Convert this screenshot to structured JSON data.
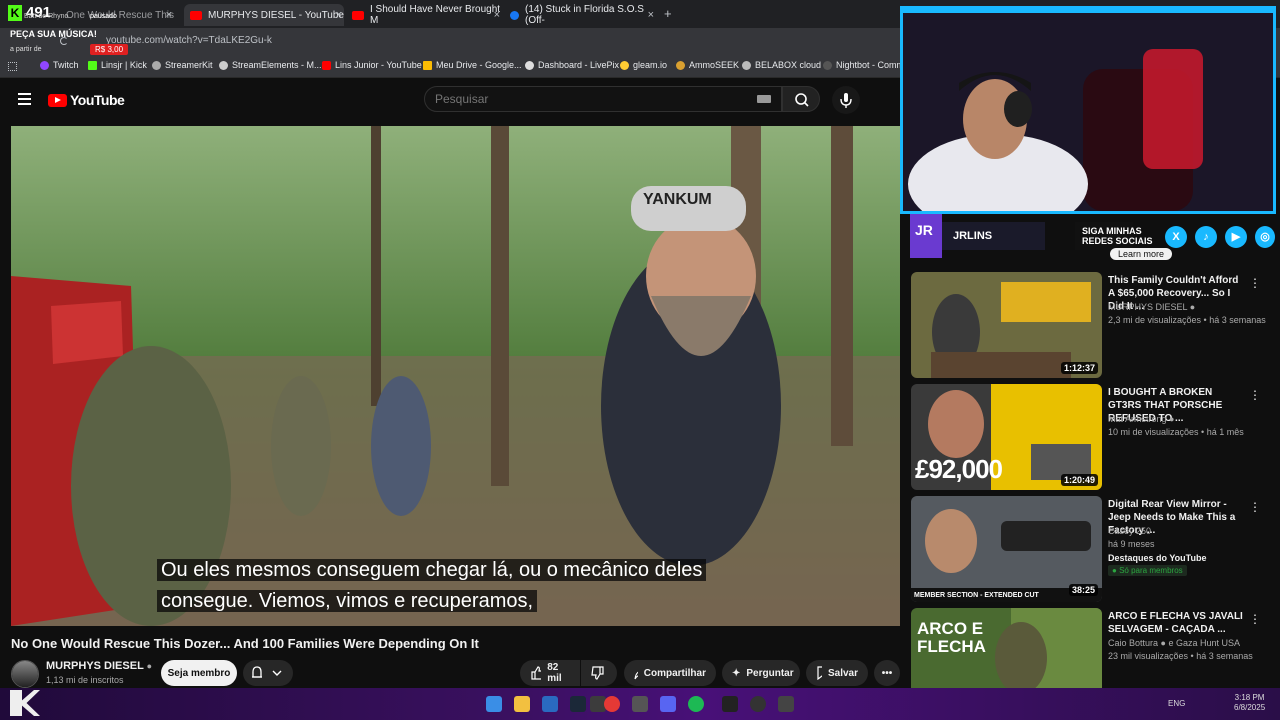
{
  "kick_overlay": {
    "count": "491",
    "title": "Batt do Rhyno",
    "status": "pausado",
    "song_request": "PEÇA SUA MÚSICA!",
    "from": "a partir de",
    "price": "R$ 3,00"
  },
  "browser": {
    "tabs": [
      {
        "label": "One Would Rescue This"
      },
      {
        "label": "MURPHYS DIESEL - YouTube"
      },
      {
        "label": "I Should Have Never Brought M"
      },
      {
        "label": "(14) Stuck in Florida S.O.S (Off-"
      }
    ],
    "new_tab": "+",
    "url": "youtube.com/watch?v=TdaLKE2Gu-k",
    "bookmarks": [
      {
        "label": "Twitch",
        "color": "#9146ff"
      },
      {
        "label": "Linsjr | Kick",
        "color": "#53fc18"
      },
      {
        "label": "StreamerKit",
        "color": "#aaaaaa"
      },
      {
        "label": "StreamElements - M...",
        "color": "#cccccc"
      },
      {
        "label": "Lins Junior - YouTube",
        "color": "#ff0000"
      },
      {
        "label": "Meu Drive - Google...",
        "color": "#fbbc04"
      },
      {
        "label": "Dashboard - LivePix",
        "color": "#dddddd"
      },
      {
        "label": "gleam.io",
        "color": "#ffcc33"
      },
      {
        "label": "AmmoSEEK",
        "color": "#d9a030"
      },
      {
        "label": "BELABOX cloud",
        "color": "#bbbbbb"
      },
      {
        "label": "Nightbot - Comm",
        "color": "#555555"
      }
    ]
  },
  "youtube": {
    "logo_text": "YouTube",
    "search_placeholder": "Pesquisar",
    "caption_line1": "Ou eles mesmos conseguem chegar lá, ou o mecânico deles",
    "caption_line2": "consegue. Viemos, vimos e recuperamos,",
    "video_hat_text": "YANKUM",
    "video_title": "No One Would Rescue This Dozer... And 100 Families Were Depending On It",
    "channel_name": "MURPHYS DIESEL",
    "channel_subs": "1,13 mi de inscritos",
    "join_label": "Seja membro",
    "likes": "82 mil",
    "share_label": "Compartilhar",
    "ask_label": "Perguntar",
    "save_label": "Salvar",
    "learn_more": "Learn more"
  },
  "stream_overlay": {
    "streamer_name": "JRLINS",
    "follow_text_1": "SIGA MINHAS",
    "follow_text_2": "REDES SOCIAIS",
    "logo_text": "JR"
  },
  "recommendations": [
    {
      "title": "This Family Couldn't Afford A $65,000 Recovery... So I Did It ...",
      "channel": "MURPHYS DIESEL",
      "views": "2,3 mi de visualizações",
      "age": "há 3 semanas",
      "duration": "1:12:37",
      "thumb_text": "",
      "verified": true
    },
    {
      "title": "I BOUGHT A BROKEN GT3RS THAT PORSCHE REFUSED TO ...",
      "channel": "Mat Armstrong",
      "views": "10 mi de visualizações",
      "age": "há 1 mês",
      "duration": "1:20:49",
      "thumb_text": "£92,000",
      "verified": true
    },
    {
      "title": "Digital Rear View Mirror - Jeep Needs to Make This a Factory ...",
      "channel": "Casey 250",
      "views": "",
      "age": "há 9 meses",
      "duration": "38:25",
      "thumb_text": "MEMBER SECTION - EXTENDED CUT",
      "badge1": "Destaques do YouTube",
      "badge2": "Só para membros"
    },
    {
      "title": "ARCO E FLECHA VS JAVALI SELVAGEM - CAÇADA ...",
      "channel": "Caio Bottura",
      "channel_extra": "e Gaza Hunt USA",
      "views": "23 mil visualizações",
      "age": "há 3 semanas",
      "duration": "",
      "thumb_text": "ARCO E FLECHA",
      "verified": true
    }
  ],
  "taskbar": {
    "lang": "ENG",
    "time": "3:18 PM",
    "date": "6/8/2025"
  }
}
